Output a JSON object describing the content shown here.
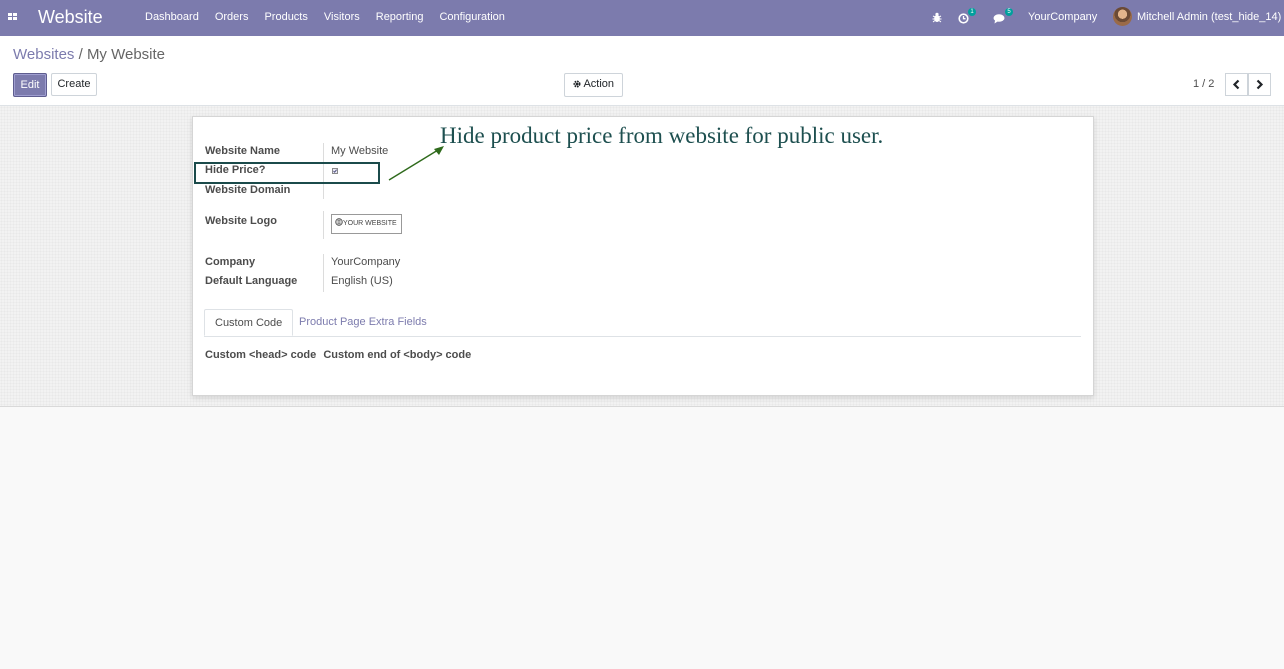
{
  "navbar": {
    "brand": "Website",
    "menu": [
      "Dashboard",
      "Orders",
      "Products",
      "Visitors",
      "Reporting",
      "Configuration"
    ],
    "activity_count": "1",
    "message_count": "5",
    "company": "YourCompany",
    "user": "Mitchell Admin (test_hide_14)",
    "color": "#7c7bad"
  },
  "breadcrumb": {
    "parent": "Websites",
    "separator": "/",
    "current": "My Website"
  },
  "buttons": {
    "edit": "Edit",
    "create": "Create",
    "action": "Action"
  },
  "pager": {
    "value": "1 / 2"
  },
  "form": {
    "website_name_label": "Website Name",
    "website_name_value": "My Website",
    "hide_price_label": "Hide Price?",
    "hide_price_checked": true,
    "website_domain_label": "Website Domain",
    "website_domain_value": "",
    "website_logo_label": "Website Logo",
    "logo_text": "YOUR WEBSITE",
    "company_label": "Company",
    "company_value": "YourCompany",
    "language_label": "Default Language",
    "language_value": "English (US)"
  },
  "annotation": "Hide product price from website for public user.",
  "tabs": [
    "Custom Code",
    "Product Page Extra Fields"
  ],
  "custom_code": {
    "head_label": "Custom <head> code",
    "body_label": "Custom end of <body> code"
  }
}
